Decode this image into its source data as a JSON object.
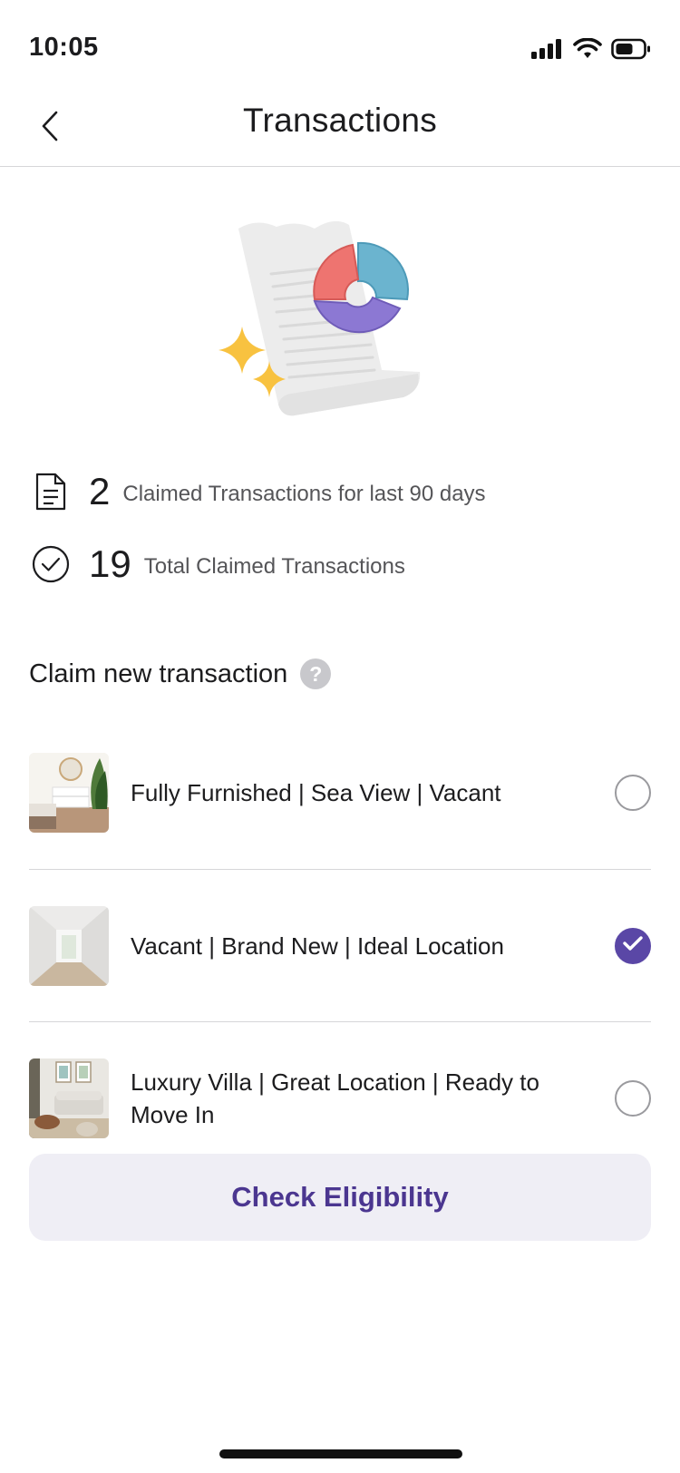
{
  "status_bar": {
    "time": "10:05"
  },
  "nav": {
    "title": "Transactions"
  },
  "stats": [
    {
      "icon": "document-icon",
      "number": "2",
      "label": "Claimed Transactions for last 90 days"
    },
    {
      "icon": "check-circle-icon",
      "number": "19",
      "label": "Total Claimed Transactions"
    }
  ],
  "claim": {
    "title": "Claim new transaction",
    "help_glyph": "?",
    "items": [
      {
        "label": "Fully Furnished | Sea View | Vacant",
        "selected": false
      },
      {
        "label": "Vacant | Brand New | Ideal Location",
        "selected": true
      },
      {
        "label": "Luxury Villa | Great Location | Ready to Move In",
        "selected": false
      }
    ]
  },
  "cta": {
    "label": "Check Eligibility"
  },
  "colors": {
    "accent": "#5a47a6",
    "cta_text": "#4b3690",
    "cta_bg": "#efeef5"
  }
}
